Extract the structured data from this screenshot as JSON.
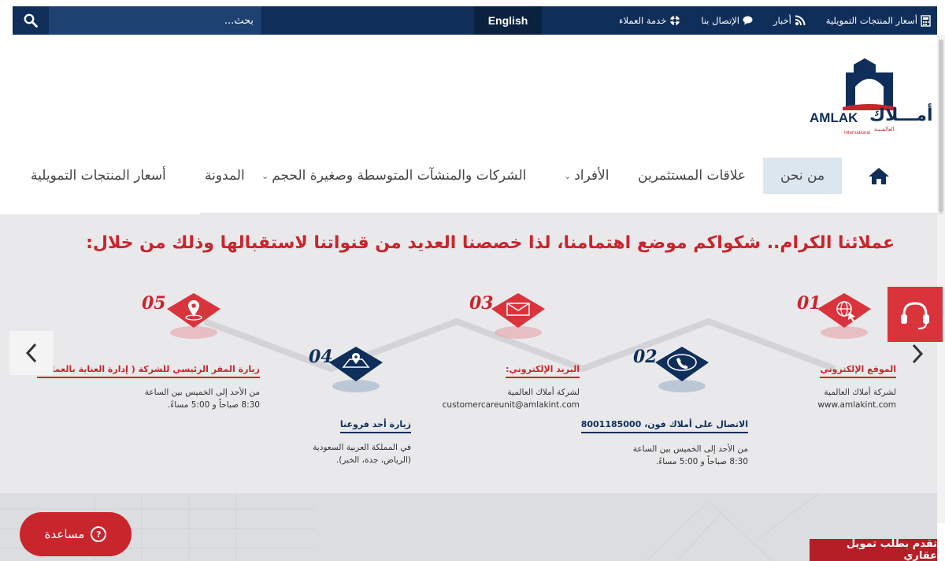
{
  "topbar": {
    "search_placeholder": "بحث...",
    "english_label": "English",
    "items": [
      {
        "label": "أسعار المنتجات التمويلية",
        "icon": "calculator-icon"
      },
      {
        "label": "أخبار",
        "icon": "rss-icon"
      },
      {
        "label": "الإتصال بنا",
        "icon": "chat-icon"
      },
      {
        "label": "خدمة العملاء",
        "icon": "support-icon"
      }
    ]
  },
  "logo": {
    "latin": "AMLAK",
    "arabic": "أمـــلاك",
    "sub_latin": "International",
    "sub_arabic": "العالمـيـة"
  },
  "nav": {
    "items": [
      {
        "label": "من نحن",
        "has_caret": false
      },
      {
        "label": "علاقات المستثمرين",
        "has_caret": false
      },
      {
        "label": "الأفراد",
        "has_caret": true
      },
      {
        "label": "الشركات والمنشآت المتوسطة وصغيرة الحجم",
        "has_caret": true
      },
      {
        "label": "المدونة",
        "has_caret": false
      },
      {
        "label": "أسعار المنتجات التمويلية",
        "has_caret": false
      }
    ],
    "caret": "⌄"
  },
  "hero": {
    "title": "عملائنا الكرام.. شكواكم موضع اهتمامنا، لذا خصصنا العديد من قنواتنا لاستقبالها وذلك من خلال:",
    "steps": [
      {
        "num": "01",
        "title": "الموقع الإلكتروني",
        "lines": [
          "لشركة أملاك العالمية",
          "www.amlakint.com"
        ]
      },
      {
        "num": "02",
        "title": "الاتصال على أملاك فون، 8001185000",
        "lines": [
          "من الأحد إلى الخميس بين الساعة",
          "8:30 صباحاً و 5:00 مساءً."
        ]
      },
      {
        "num": "03",
        "title": "البريد الإلكتروني:",
        "lines": [
          "لشركة أملاك العالمية",
          "customercareunit@amlakint.com"
        ]
      },
      {
        "num": "04",
        "title": "زيارة أحد فروعنا",
        "lines": [
          "في المملكة العربية السعودية",
          "(الرياض، جدة، الخبر)."
        ]
      },
      {
        "num": "05",
        "title": "زيارة المقر الرئيسي للشركة ( إدارة العناية بالعملاء )",
        "lines": [
          "من الأحد إلى الخميس بين الساعة",
          "8:30 صباحاً و 5:00 مساءً."
        ]
      }
    ]
  },
  "help_button": {
    "label": "مساعدة",
    "icon_text": "?"
  },
  "loan_button": {
    "label": "تقدم بطلب تمويل عقاري"
  },
  "colors": {
    "navy": "#0f2e5a",
    "red": "#c9252c",
    "hero_bg": "#e9e9eb"
  }
}
